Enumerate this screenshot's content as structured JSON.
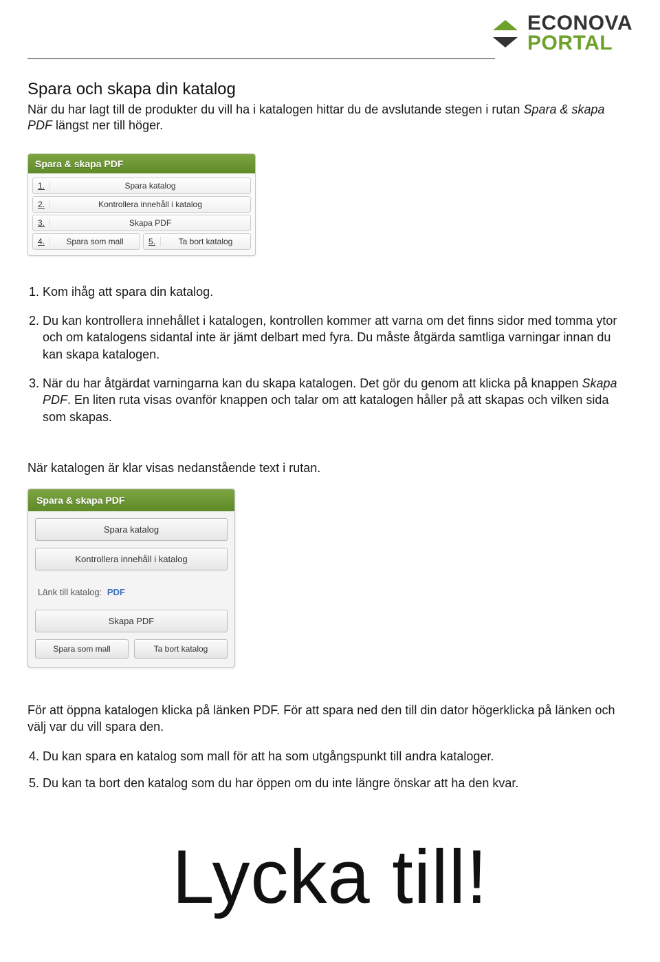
{
  "logo": {
    "line1": "ECONOVA",
    "line2": "PORTAL"
  },
  "section": {
    "title": "Spara och skapa din katalog",
    "intro_a": "När du har lagt till de produkter du vill ha i katalogen hittar du de avslutande stegen i rutan ",
    "intro_em": "Spara & skapa PDF",
    "intro_b": " längst ner till höger."
  },
  "widget1": {
    "header": "Spara & skapa PDF",
    "rows": [
      {
        "n": "1.",
        "label": "Spara katalog"
      },
      {
        "n": "2.",
        "label": "Kontrollera innehåll i katalog"
      },
      {
        "n": "3.",
        "label": "Skapa PDF"
      }
    ],
    "row4": {
      "n": "4.",
      "label": "Spara som mall"
    },
    "row5": {
      "n": "5.",
      "label": "Ta bort katalog"
    }
  },
  "list_main": [
    "Kom ihåg att spara din katalog.",
    "Du kan kontrollera innehållet i katalogen, kontrollen kommer att varna om det finns sidor med tomma ytor och om katalogens sidantal inte är jämt delbart med fyra. Du måste åtgärda samtliga varningar innan du kan skapa katalogen.",
    "item3_composed"
  ],
  "item3": {
    "a": "När du har åtgärdat varningarna kan du skapa katalogen. Det gör du genom att klicka på knappen ",
    "em": "Skapa PDF",
    "b": ". En liten ruta visas ovanför knappen och talar om att katalogen håller på att skapas och vilken sida som skapas."
  },
  "mid_text": "När katalogen är klar visas nedanstående text i rutan.",
  "widget2": {
    "header": "Spara & skapa PDF",
    "btn1": "Spara katalog",
    "btn2": "Kontrollera innehåll i katalog",
    "link_label": "Länk till katalog:",
    "link_text": "PDF",
    "btn3": "Skapa PDF",
    "btn4": "Spara som mall",
    "btn5": "Ta bort katalog"
  },
  "after_widget": "För att öppna katalogen klicka på länken PDF. För att spara ned den till din dator högerklicka på länken och välj var du vill spara den.",
  "tail_items": {
    "4": "Du kan spara en katalog som mall för att ha som utgångspunkt till andra kataloger.",
    "5": "Du kan ta bort den katalog som du har öppen om du inte längre önskar att ha den kvar."
  },
  "finale": "Lycka till!"
}
